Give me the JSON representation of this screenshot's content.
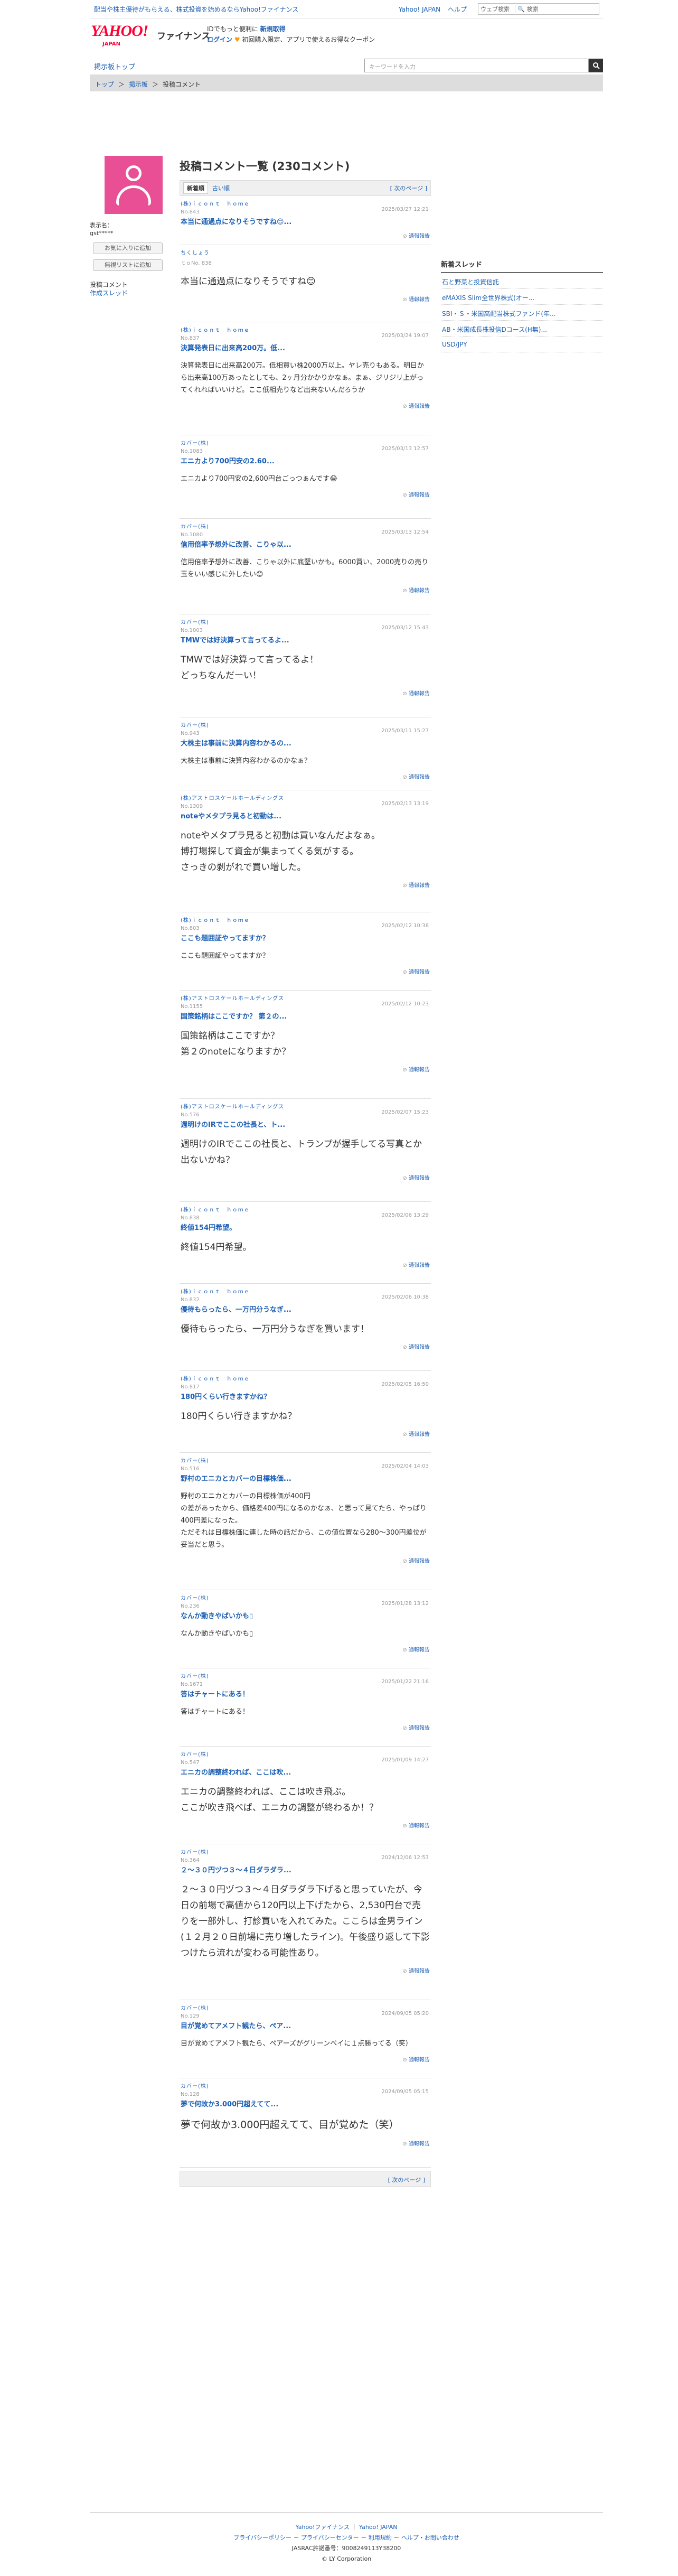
{
  "topbar": {
    "promo": "配当や株主優待がもらえる、株式投資を始めるならYahoo!ファイナンス",
    "links": [
      "Yahoo! JAPAN",
      "ヘルプ"
    ],
    "search_select": "ウェブ検索",
    "search_placeholder": "検索",
    "search_button": "検索"
  },
  "header": {
    "logo_main": "YAHOO!",
    "logo_sub": "JAPAN",
    "service": "ファイナンス",
    "tagline": "IDでもっと便利に",
    "tagline_link": "新規取得",
    "login": "ログイン",
    "promo": "初回購入限定、アプリで使えるお得なクーポン"
  },
  "nav": {
    "top_link": "掲示板トップ",
    "search_placeholder": "キーワードを入力"
  },
  "breadcrumb": [
    "トップ",
    "掲示板",
    "投稿コメント"
  ],
  "profile": {
    "label": "表示名：",
    "name": "gst*****",
    "btn_favorite": "お気に入りに追加",
    "btn_ignore": "無視リストに追加",
    "menu_current": "投稿コメント",
    "menu_link": "作成スレッド"
  },
  "sidebar": {
    "heading": "新着スレッド",
    "items": [
      "石と野菜と投資信託",
      "eMAXIS Slim全世界株式(オー...",
      "SBI・Ｓ・米国高配当株式ファンド(年...",
      "AB・米国成長株投信Dコース(H無)...",
      "USD/JPY"
    ]
  },
  "main": {
    "title": "投稿コメント一覧 (230コメント)",
    "sort_new": "新着順",
    "sort_old": "古い順",
    "next_page": "[ 次のページ ]",
    "report_label": "通報報告"
  },
  "comments": [
    {
      "user": "(株)ｉｃｏｎｔ　ｈｏｍｅ",
      "no": "No.843",
      "date": "2025/03/27 12:21",
      "title": "本当に通過点になりそうですね😊...",
      "body": "",
      "size": "s"
    },
    {
      "user": "ちくしょう",
      "no": "ｔｏNo. 838",
      "date": "",
      "title": "",
      "body": "本当に通過点になりそうですね😊",
      "size": "m"
    },
    {
      "user": "(株)ｉｃｏｎｔ　ｈｏｍｅ",
      "no": "No.837",
      "date": "2025/03/24 19:07",
      "title": "決算発表日に出来高200万。低...",
      "body": "決算発表日に出来高200万。低相買い株2000万以上。ヤレ売りもある。明日から出来高100万あったとしても、2ヶ月分かかりかなぁ。まぁ、ジリジリ上がってくれればいいけど。ここ低相売りなど出来ないんだろうか",
      "size": "s"
    },
    {
      "user": "カバー(株)",
      "no": "No.1083",
      "date": "2025/03/13 12:57",
      "title": "エニカより700円安の2.60...",
      "body": "エニカより700円安の2,600円台ごっつぁんです😂",
      "size": "s"
    },
    {
      "user": "カバー(株)",
      "no": "No.1080",
      "date": "2025/03/13 12:54",
      "title": "信用倍率予想外に改善、こりゃ以...",
      "body": "信用倍率予想外に改善、こりゃ以外に底堅いかも。6000買い、2000売りの売り玉をいい感じに外したい😊",
      "size": "s"
    },
    {
      "user": "カバー(株)",
      "no": "No.1003",
      "date": "2025/03/12 15:43",
      "title": "TMWでは好決算って言ってるよ...",
      "body": "TMWでは好決算って言ってるよ！\nどっちなんだーい！",
      "size": "m"
    },
    {
      "user": "カバー(株)",
      "no": "No.943",
      "date": "2025/03/11 15:27",
      "title": "大株主は事前に決算内容わかるの...",
      "body": "大株主は事前に決算内容わかるのかなぁ？",
      "size": "s"
    },
    {
      "user": "(株)アストロスケールホールディングス",
      "no": "No.1309",
      "date": "2025/02/13 13:19",
      "title": "noteやメタプラ見ると初動は...",
      "body": "noteやメタプラ見ると初動は買いなんだよなぁ。\n博打場探して資金が集まってくる気がする。\nさっきの剥がれで買い増した。",
      "size": "m"
    },
    {
      "user": "(株)ｉｃｏｎｔ　ｈｏｍｅ",
      "no": "No.803",
      "date": "2025/02/12 10:38",
      "title": "ここも題囲証やってますか？",
      "body": "ここも題囲証やってますか？",
      "size": "s"
    },
    {
      "user": "(株)アストロスケールホールディングス",
      "no": "No.1155",
      "date": "2025/02/12 10:23",
      "title": "国策銘柄はここですか？ 第２の...",
      "body": "国策銘柄はここですか？\n第２のnoteになりますか？",
      "size": "m"
    },
    {
      "user": "(株)アストロスケールホールディングス",
      "no": "No.576",
      "date": "2025/02/07 15:23",
      "title": "週明けのIRでここの社長と、ト...",
      "body": "週明けのIRでここの社長と、トランプが握手してる写真とか出ないかね？",
      "size": "m"
    },
    {
      "user": "(株)ｉｃｏｎｔ　ｈｏｍｅ",
      "no": "No.838",
      "date": "2025/02/06 13:29",
      "title": "終値154円希望。",
      "body": "終値154円希望。",
      "size": "m"
    },
    {
      "user": "(株)ｉｃｏｎｔ　ｈｏｍｅ",
      "no": "No.832",
      "date": "2025/02/06 10:38",
      "title": "優待もらったら、一万円分うなぎ...",
      "body": "優待もらったら、一万円分うなぎを買います！",
      "size": "m"
    },
    {
      "user": "(株)ｉｃｏｎｔ　ｈｏｍｅ",
      "no": "No.817",
      "date": "2025/02/05 16:50",
      "title": "180円くらい行きますかね？",
      "body": "180円くらい行きますかね？",
      "size": "m"
    },
    {
      "user": "カバー(株)",
      "no": "No.516",
      "date": "2025/02/04 14:03",
      "title": "野村のエニカとカバーの目標株価...",
      "body": "野村のエニカとカバーの目標株価が400円\nの差があったから、価格差400円になるのかなぁ、と思って見てたら、やっぱり400円差になった。\nただそれは目標株価に連した時の話だから、この値位置なら280〜300円差位が妥当だと思う。",
      "size": "s"
    },
    {
      "user": "カバー(株)",
      "no": "No.236",
      "date": "2025/01/28 13:12",
      "title": "なんか動きやばいかも▯",
      "body": "なんか動きやばいかも▯",
      "size": "s"
    },
    {
      "user": "カバー(株)",
      "no": "No.1671",
      "date": "2025/01/22 21:16",
      "title": "答はチャートにある！",
      "body": "答はチャートにある！",
      "size": "s"
    },
    {
      "user": "カバー(株)",
      "no": "No.547",
      "date": "2025/01/09 14:27",
      "title": "エニカの調整終われば、ここは吹...",
      "body": "エニカの調整終われば、ここは吹き飛ぶ。\nここが吹き飛べば、エニカの調整が終わるか！？",
      "size": "m"
    },
    {
      "user": "カバー(株)",
      "no": "No.364",
      "date": "2024/12/06 12:53",
      "title": "２〜３０円ヅつ３〜４日ダラダラ...",
      "body": "２〜３０円ヅつ３〜４日ダラダラ下げると思っていたが、今日の前場で高値から120円以上下げたから、2,530円台で売りを一部外し、打診買いを入れてみた。ここらは金男ライン(１２月２０日前場に売り増したライン)。午後盛り返して下影つけたら流れが変わる可能性あり。",
      "size": "m"
    },
    {
      "user": "カバー(株)",
      "no": "No.129",
      "date": "2024/09/05 05:20",
      "title": "目が覚めてアメフト観たら、ペア...",
      "body": "目が覚めてアメフト観たら、ペアーズがグリーンベイに１点勝ってる（笑）",
      "size": "s"
    },
    {
      "user": "カバー(株)",
      "no": "No.128",
      "date": "2024/09/05 05:15",
      "title": "夢で何故か3.000円超えてて...",
      "body": "夢で何故か3.000円超えてて、目が覚めた（笑）",
      "size": "l"
    }
  ],
  "footer": {
    "links1": [
      "Yahoo!ファイナンス",
      "Yahoo! JAPAN"
    ],
    "links2": [
      "プライバシーポリシー",
      "プライバシーセンター",
      "利用規約",
      "ヘルプ・お問い合わせ"
    ],
    "code": "JASRAC許諾番号：9008249113Y38200",
    "copyright": "© LY Corporation"
  }
}
